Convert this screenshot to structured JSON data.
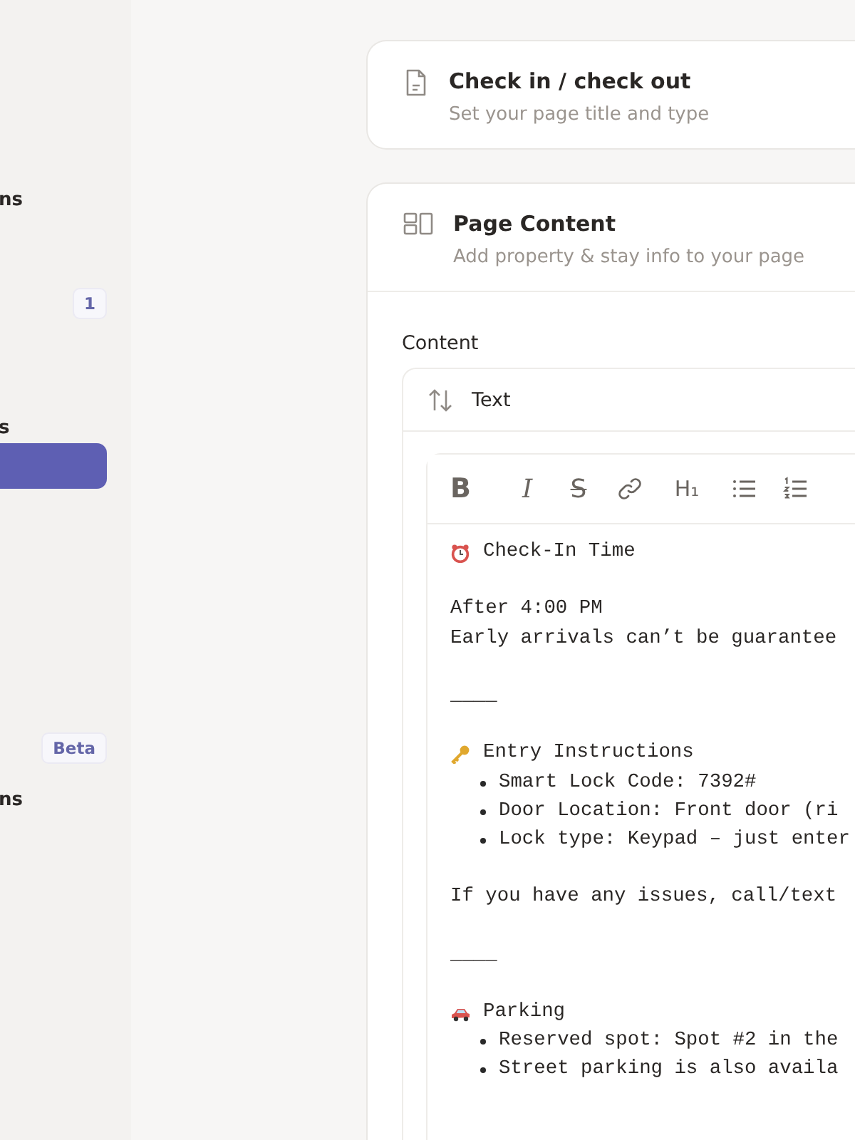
{
  "sidebar": {
    "items": [
      {
        "kind": "label",
        "label": "ns",
        "selected": false
      },
      {
        "kind": "badge",
        "badge": "1",
        "selected": false
      },
      {
        "kind": "label",
        "label": "s",
        "selected": false
      },
      {
        "kind": "bar",
        "selected": true
      },
      {
        "kind": "badge",
        "badge": "Beta",
        "selected": false
      },
      {
        "kind": "label",
        "label": "ns",
        "selected": false
      }
    ]
  },
  "sections": [
    {
      "kind": "page",
      "title": "Check in / check out",
      "subtitle": "Set your page title and type"
    },
    {
      "kind": "layout",
      "title": "Page Content",
      "subtitle": "Add property & stay info to your page"
    }
  ],
  "content": {
    "label": "Content",
    "block_type": "Text",
    "toolbar": [
      {
        "kind": "bold",
        "label": "B"
      },
      {
        "kind": "italic",
        "label": "I"
      },
      {
        "kind": "strike",
        "label": "S"
      },
      {
        "kind": "link"
      },
      {
        "kind": "heading",
        "label": "H₁"
      },
      {
        "kind": "bullets"
      },
      {
        "kind": "numbers"
      }
    ],
    "lines": [
      {
        "kind": "clockheading",
        "text": "Check-In Time"
      },
      {
        "kind": "blank"
      },
      {
        "kind": "text",
        "text": "After 4:00 PM"
      },
      {
        "kind": "text",
        "text": "Early arrivals can’t be guarantee"
      },
      {
        "kind": "blank"
      },
      {
        "kind": "text",
        "text": "____"
      },
      {
        "kind": "blank"
      },
      {
        "kind": "keyheading",
        "text": "Entry Instructions"
      },
      {
        "kind": "bullet",
        "text": "Smart Lock Code: 7392#"
      },
      {
        "kind": "bullet",
        "text": "Door Location: Front door (ri"
      },
      {
        "kind": "bullet",
        "text": "Lock type: Keypad – just enter"
      },
      {
        "kind": "blank"
      },
      {
        "kind": "text",
        "text": "If you have any issues, call/text"
      },
      {
        "kind": "blank"
      },
      {
        "kind": "text",
        "text": "____"
      },
      {
        "kind": "blank"
      },
      {
        "kind": "carheading",
        "text": "Parking"
      },
      {
        "kind": "bullet",
        "text": "Reserved spot: Spot #2 in the"
      },
      {
        "kind": "bullet",
        "text": "Street parking is also availa"
      }
    ]
  }
}
